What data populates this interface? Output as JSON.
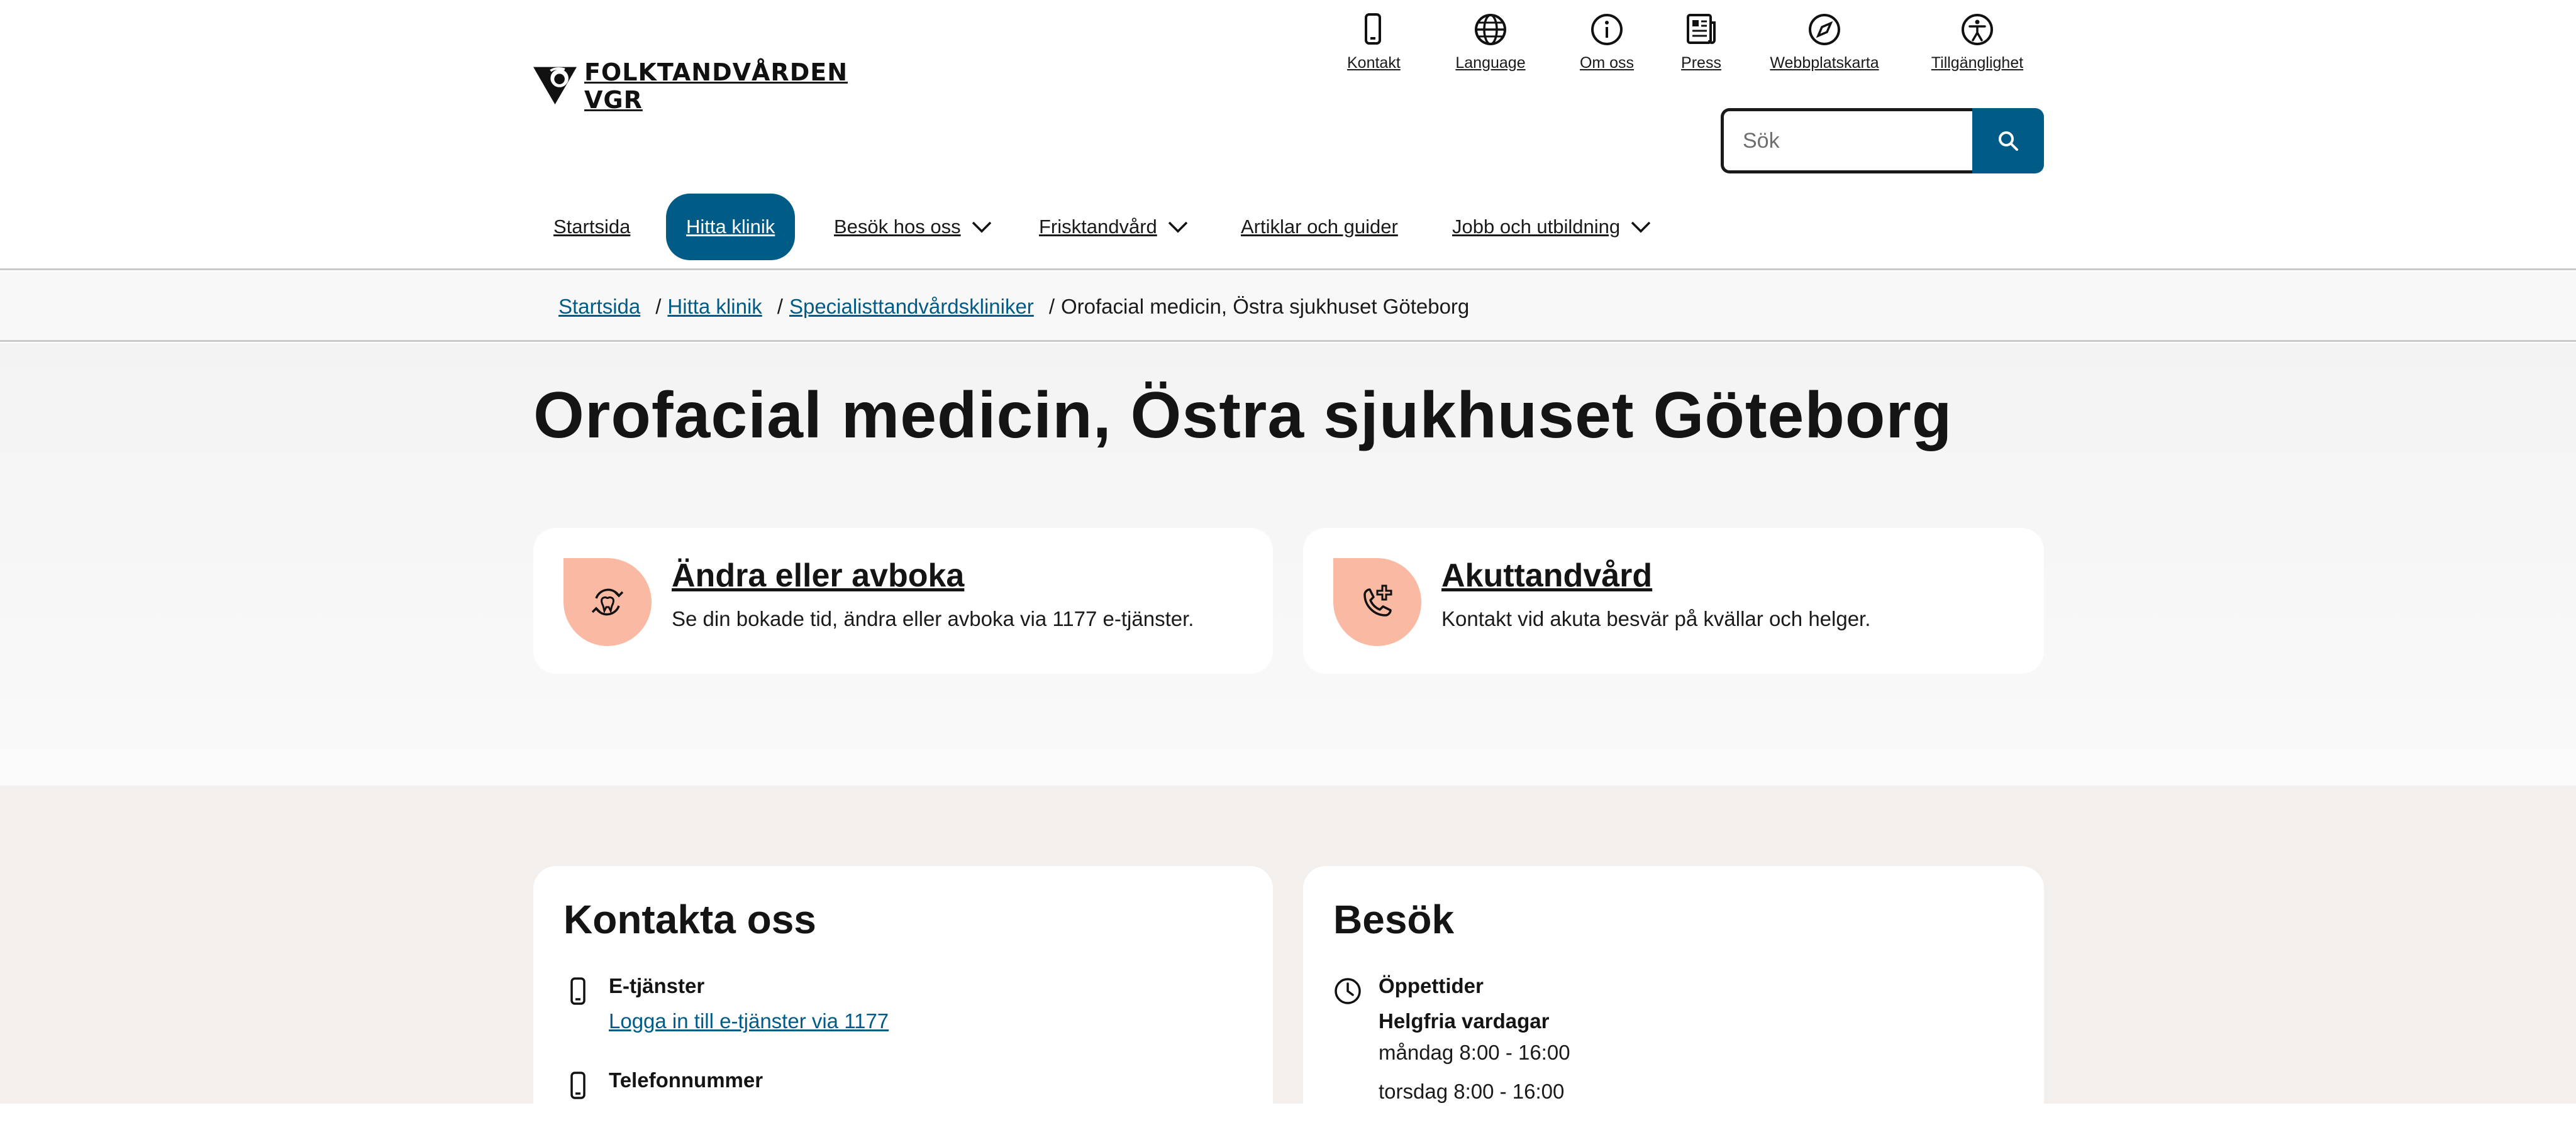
{
  "header": {
    "logo_line1": "FOLKTANDVÅRDEN",
    "logo_line2": "VGR",
    "utility_nav": [
      {
        "label": "Kontakt",
        "icon": "phone-icon"
      },
      {
        "label": "Language",
        "icon": "globe-icon"
      },
      {
        "label": "Om oss",
        "icon": "info-icon"
      },
      {
        "label": "Press",
        "icon": "newspaper-icon"
      },
      {
        "label": "Webbplatskarta",
        "icon": "compass-icon"
      },
      {
        "label": "Tillgänglighet",
        "icon": "accessibility-icon"
      }
    ],
    "search": {
      "placeholder": "Sök",
      "button_icon": "search-icon"
    },
    "main_nav": [
      {
        "label": "Startsida",
        "has_dropdown": false,
        "active": false
      },
      {
        "label": "Hitta klinik",
        "has_dropdown": false,
        "active": true
      },
      {
        "label": "Besök hos oss",
        "has_dropdown": true,
        "active": false
      },
      {
        "label": "Frisktandvård",
        "has_dropdown": true,
        "active": false
      },
      {
        "label": "Artiklar och guider",
        "has_dropdown": false,
        "active": false
      },
      {
        "label": "Jobb och utbildning",
        "has_dropdown": true,
        "active": false
      }
    ],
    "accent_color": "#005b86"
  },
  "breadcrumb": {
    "items": [
      "Startsida",
      "Hitta klinik",
      "Specialisttandvårdskliniker"
    ],
    "separator": "/",
    "current": "Orofacial medicin, Östra sjukhuset Göteborg"
  },
  "page": {
    "title": "Orofacial medicin, Östra sjukhuset Göteborg"
  },
  "quick_links": [
    {
      "title": "Ändra eller avboka",
      "description": "Se din bokade tid, ändra eller avboka via 1177 e-tjänster.",
      "icon": "rebook-tooth-icon"
    },
    {
      "title": "Akuttandvård",
      "description": "Kontakt vid akuta besvär på kvällar och helger.",
      "icon": "emergency-phone-icon"
    }
  ],
  "contact": {
    "title": "Kontakta oss",
    "etjanster_label": "E-tjänster",
    "etjanster_link": "Logga in till e-tjänster via 1177",
    "phone_label": "Telefonnummer"
  },
  "visit": {
    "title": "Besök",
    "hours_label": "Öppettider",
    "hours_group": "Helgfria vardagar",
    "hours_lines": [
      "måndag 8:00 - 16:00",
      "torsdag 8:00 - 16:00"
    ]
  },
  "colors": {
    "icon_badge": "#f9b9a2",
    "info_background": "#f2efed"
  }
}
